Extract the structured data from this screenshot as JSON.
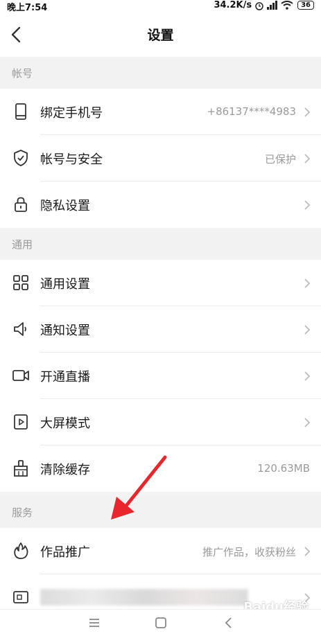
{
  "status_bar": {
    "time": "晚上7:54",
    "speed": "34.2K/s",
    "battery": "36"
  },
  "header": {
    "title": "设置"
  },
  "sections": [
    {
      "label": "帐号"
    },
    {
      "label": "通用"
    },
    {
      "label": "服务"
    }
  ],
  "rows": [
    {
      "label": "绑定手机号",
      "value": "+86137****4983",
      "icon": "phone-icon"
    },
    {
      "label": "帐号与安全",
      "value": "已保护",
      "icon": "shield-icon"
    },
    {
      "label": "隐私设置",
      "value": "",
      "icon": "lock-icon"
    },
    {
      "label": "通用设置",
      "value": "",
      "icon": "grid-icon"
    },
    {
      "label": "通知设置",
      "value": "",
      "icon": "speaker-icon"
    },
    {
      "label": "开通直播",
      "value": "",
      "icon": "video-camera-icon"
    },
    {
      "label": "大屏模式",
      "value": "",
      "icon": "play-screen-icon"
    },
    {
      "label": "清除缓存",
      "value": "120.63MB",
      "icon": "broom-icon"
    },
    {
      "label": "作品推广",
      "value": "推广作品，收获粉丝",
      "icon": "flame-icon"
    }
  ],
  "watermark": "Baidu经验",
  "colors": {
    "accent_arrow": "#e8262d",
    "section_bg": "#f2f2f2",
    "muted_text": "#9a9a9a"
  }
}
